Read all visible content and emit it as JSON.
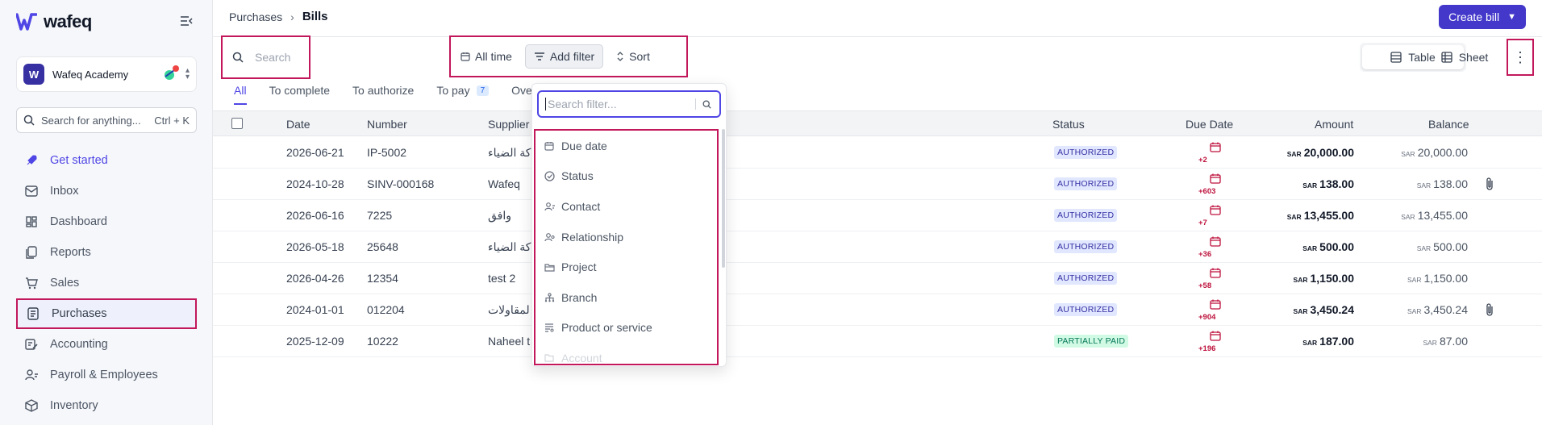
{
  "app": {
    "logo_text": "wafeq"
  },
  "org": {
    "avatar_letter": "W",
    "name": "Wafeq Academy"
  },
  "sidebar": {
    "search_placeholder": "Search for anything...",
    "search_shortcut": "Ctrl + K",
    "items": [
      {
        "label": "Get started",
        "icon": "rocket-icon"
      },
      {
        "label": "Inbox",
        "icon": "inbox-icon"
      },
      {
        "label": "Dashboard",
        "icon": "dashboard-icon"
      },
      {
        "label": "Reports",
        "icon": "reports-icon"
      },
      {
        "label": "Sales",
        "icon": "cart-icon"
      },
      {
        "label": "Purchases",
        "icon": "purchases-icon"
      },
      {
        "label": "Accounting",
        "icon": "accounting-icon"
      },
      {
        "label": "Payroll & Employees",
        "icon": "people-icon"
      },
      {
        "label": "Inventory",
        "icon": "box-icon"
      }
    ]
  },
  "header": {
    "breadcrumb_parent": "Purchases",
    "breadcrumb_current": "Bills",
    "create_label": "Create bill"
  },
  "toolbar": {
    "search_placeholder": "Search",
    "all_time": "All time",
    "add_filter": "Add filter",
    "sort": "Sort",
    "view_table": "Table",
    "view_sheet": "Sheet"
  },
  "tabs": [
    {
      "label": "All"
    },
    {
      "label": "To complete"
    },
    {
      "label": "To authorize"
    },
    {
      "label": "To pay",
      "count": "7"
    },
    {
      "label": "Ove"
    }
  ],
  "table": {
    "columns": {
      "date": "Date",
      "number": "Number",
      "supplier": "Supplier",
      "status": "Status",
      "due": "Due Date",
      "amount": "Amount",
      "balance": "Balance"
    },
    "currency": "SAR",
    "rows": [
      {
        "date": "2026-06-21",
        "number": "IP-5002",
        "supplier": "كة الضياء",
        "status": "AUTHORIZED",
        "due": "+2",
        "amount": "20,000.00",
        "balance": "20,000.00",
        "attachment": false
      },
      {
        "date": "2024-10-28",
        "number": "SINV-000168",
        "supplier": "Wafeq",
        "status": "AUTHORIZED",
        "due": "+603",
        "amount": "138.00",
        "balance": "138.00",
        "attachment": true
      },
      {
        "date": "2026-06-16",
        "number": "7225",
        "supplier": "وافق",
        "status": "AUTHORIZED",
        "due": "+7",
        "amount": "13,455.00",
        "balance": "13,455.00",
        "attachment": false
      },
      {
        "date": "2026-05-18",
        "number": "25648",
        "supplier": "كة الضياء",
        "status": "AUTHORIZED",
        "due": "+36",
        "amount": "500.00",
        "balance": "500.00",
        "attachment": false
      },
      {
        "date": "2026-04-26",
        "number": "12354",
        "supplier": "test 2",
        "status": "AUTHORIZED",
        "due": "+58",
        "amount": "1,150.00",
        "balance": "1,150.00",
        "attachment": false
      },
      {
        "date": "2024-01-01",
        "number": "012204",
        "supplier": "لمقاولات",
        "status": "AUTHORIZED",
        "due": "+904",
        "amount": "3,450.24",
        "balance": "3,450.24",
        "attachment": true
      },
      {
        "date": "2025-12-09",
        "number": "10222",
        "supplier": "Naheel t",
        "status": "PARTIALLY PAID",
        "due": "+196",
        "amount": "187.00",
        "balance": "87.00",
        "attachment": false
      }
    ]
  },
  "filter_dropdown": {
    "placeholder": "Search filter...",
    "items": [
      {
        "label": "Due date",
        "icon": "calendar-icon"
      },
      {
        "label": "Status",
        "icon": "check-circle-icon"
      },
      {
        "label": "Contact",
        "icon": "contact-icon"
      },
      {
        "label": "Relationship",
        "icon": "relationship-icon"
      },
      {
        "label": "Project",
        "icon": "folder-icon"
      },
      {
        "label": "Branch",
        "icon": "branch-icon"
      },
      {
        "label": "Product or service",
        "icon": "list-icon"
      },
      {
        "label": "Account",
        "icon": "account-icon"
      }
    ]
  },
  "colors": {
    "accent": "#4f46e5",
    "primary_button": "#4338ca",
    "highlight_border": "#c2185b",
    "overdue": "#be123c"
  }
}
